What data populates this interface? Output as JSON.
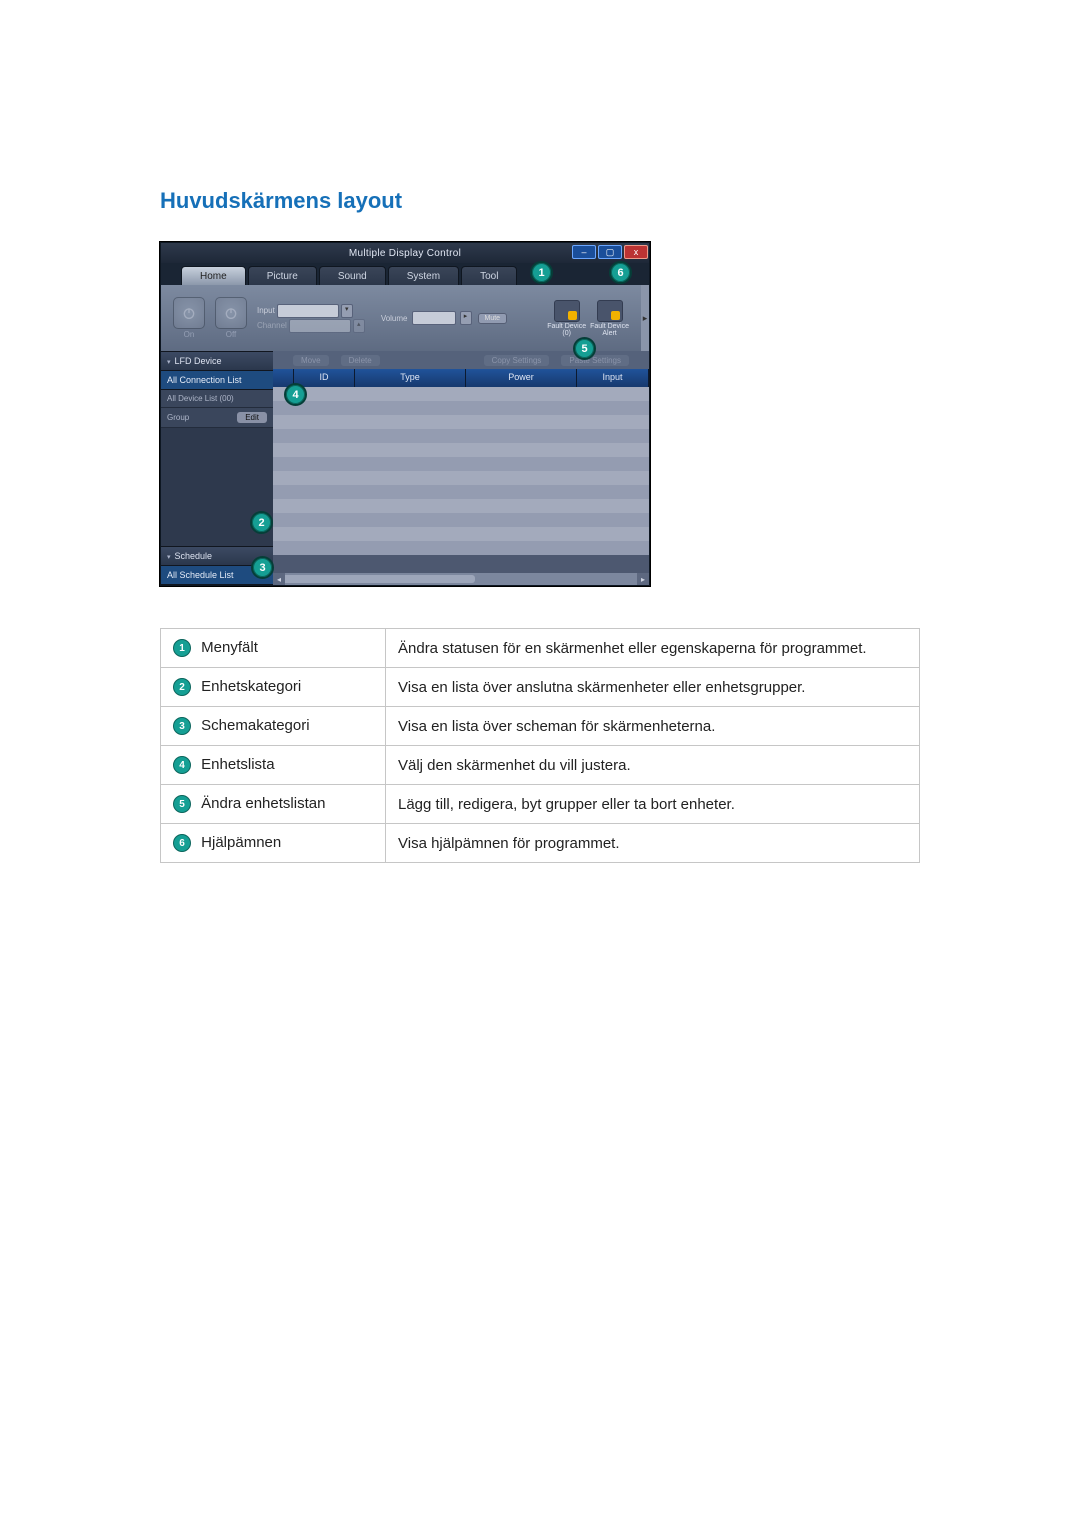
{
  "title": "Huvudskärmens layout",
  "mdc": {
    "window_title": "Multiple Display Control",
    "win_min": "–",
    "win_max": "▢",
    "win_close": "x",
    "tabs": {
      "home": "Home",
      "picture": "Picture",
      "sound": "Sound",
      "system": "System",
      "tool": "Tool"
    },
    "ribbon": {
      "on": "On",
      "off": "Off",
      "input": "Input",
      "channel": "Channel",
      "volume": "Volume",
      "mute": "Mute",
      "fault0_line1": "Fault Device",
      "fault0_line2": "(0)",
      "fault1_line1": "Fault Device",
      "fault1_line2": "Alert",
      "next": "▸"
    },
    "side": {
      "lfd": "LFD Device",
      "all_conn": "All Connection List",
      "all_dev": "All Device List (00)",
      "group": "Group",
      "edit": "Edit",
      "schedule": "Schedule",
      "all_sched": "All Schedule List"
    },
    "toolbar": {
      "move": "Move",
      "delete": "Delete",
      "copy": "Copy Settings",
      "paste": "Paste Settings"
    },
    "cols": {
      "id": "ID",
      "type": "Type",
      "power": "Power",
      "input": "Input"
    },
    "scroll_l": "◂",
    "scroll_r": "▸"
  },
  "legend": {
    "rows": [
      {
        "n": "1",
        "name": "Menyfält",
        "desc": "Ändra statusen för en skärmenhet eller egenskaperna för programmet."
      },
      {
        "n": "2",
        "name": "Enhetskategori",
        "desc": "Visa en lista över anslutna skärmenheter eller enhetsgrupper."
      },
      {
        "n": "3",
        "name": "Schemakategori",
        "desc": "Visa en lista över scheman för skärmenheterna."
      },
      {
        "n": "4",
        "name": "Enhetslista",
        "desc": "Välj den skärmenhet du vill justera."
      },
      {
        "n": "5",
        "name": "Ändra enhetslistan",
        "desc": "Lägg till, redigera, byt grupper eller ta bort enheter."
      },
      {
        "n": "6",
        "name": "Hjälpämnen",
        "desc": "Visa hjälpämnen för programmet."
      }
    ]
  }
}
